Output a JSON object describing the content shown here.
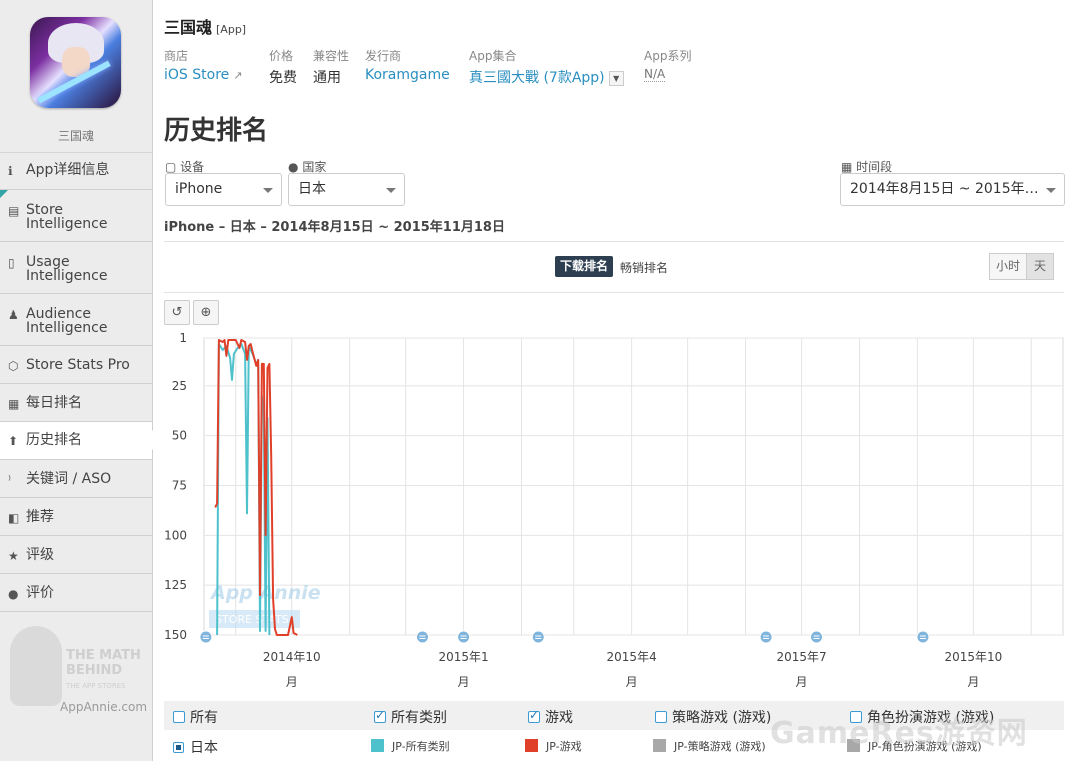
{
  "sidebar": {
    "app_name": "三国魂",
    "items": [
      {
        "icon": "info-icon",
        "glyph": "ℹ",
        "label": "App详细信息"
      },
      {
        "icon": "store-intelligence-icon",
        "glyph": "▤",
        "label": "Store Intelligence"
      },
      {
        "icon": "usage-intelligence-icon",
        "glyph": "▯",
        "label": "Usage Intelligence"
      },
      {
        "icon": "audience-intelligence-icon",
        "glyph": "♟",
        "label": "Audience Intelligence"
      },
      {
        "icon": "store-stats-pro-icon",
        "glyph": "⬡",
        "label": "Store Stats Pro"
      },
      {
        "icon": "calendar-icon",
        "glyph": "▦",
        "label": "每日排名"
      },
      {
        "icon": "arrow-up-icon",
        "glyph": "⬆",
        "label": "历史排名"
      },
      {
        "icon": "keyword-icon",
        "glyph": "⁾",
        "label": "关键词 / ASO"
      },
      {
        "icon": "featured-icon",
        "glyph": "◧",
        "label": "推荐"
      },
      {
        "icon": "star-icon",
        "glyph": "★",
        "label": "评级"
      },
      {
        "icon": "review-icon",
        "glyph": "●",
        "label": "评价"
      }
    ],
    "logo": {
      "line1": "THE MATH",
      "line2": "BEHIND",
      "line3": "THE APP STORES",
      "url": "AppAnnie.com"
    }
  },
  "header": {
    "title": "三国魂",
    "tag": "[App]",
    "meta": [
      {
        "label": "商店",
        "value": "iOS Store"
      },
      {
        "label": "价格",
        "value": "免费"
      },
      {
        "label": "兼容性",
        "value": "通用"
      },
      {
        "label": "发行商",
        "value": "Koramgame"
      },
      {
        "label": "App集合",
        "value": "真三國大戰 (7款App)"
      },
      {
        "label": "App系列",
        "value": "N/A"
      }
    ]
  },
  "section_title": "历史排名",
  "filters": {
    "device_label": "设备",
    "device_value": "iPhone",
    "country_label": "国家",
    "country_value": "日本",
    "period_label": "时间段",
    "period_value": "2014年8月15日 ~ 2015年…"
  },
  "subtitle": "iPhone – 日本 – 2014年8月15日 ~ 2015年11月18日",
  "tabs": {
    "active": "下载排名",
    "other": "畅销排名"
  },
  "granularity": {
    "hour": "小时",
    "day": "天"
  },
  "watermark_chart": {
    "line1": "App Annie",
    "line2": "STORE STATS"
  },
  "colors": {
    "all_categories": "#4dc1cc",
    "games": "#e0402a",
    "grey": "#a8a8a8",
    "accent": "#2a8fc0"
  },
  "chart_data": {
    "type": "line",
    "y_reversed": true,
    "ylim": [
      1,
      150
    ],
    "yticks": [
      1,
      25,
      50,
      75,
      100,
      125,
      150
    ],
    "xticks": [
      {
        "label": "2014年10月",
        "date": "2014-10-01"
      },
      {
        "label": "2015年1月",
        "date": "2015-01-01"
      },
      {
        "label": "2015年4月",
        "date": "2015-04-01"
      },
      {
        "label": "2015年7月",
        "date": "2015-07-01"
      },
      {
        "label": "2015年10月",
        "date": "2015-10-01"
      }
    ],
    "xlim": [
      "2014-08-15",
      "2015-11-18"
    ],
    "events": [
      "2014-08-16",
      "2014-12-10",
      "2015-01-01",
      "2015-02-10",
      "2015-06-12",
      "2015-07-09",
      "2015-09-04"
    ],
    "series": [
      {
        "name": "JP-所有类别",
        "color": "#4dc1cc",
        "points": [
          [
            "2014-08-22",
            150
          ],
          [
            "2014-08-23",
            4
          ],
          [
            "2014-08-25",
            7
          ],
          [
            "2014-08-27",
            5
          ],
          [
            "2014-08-29",
            11
          ],
          [
            "2014-08-30",
            22
          ],
          [
            "2014-08-31",
            9
          ],
          [
            "2014-09-02",
            6
          ],
          [
            "2014-09-04",
            4
          ],
          [
            "2014-09-06",
            9
          ],
          [
            "2014-09-07",
            89
          ],
          [
            "2014-09-08",
            5
          ],
          [
            "2014-09-10",
            9
          ],
          [
            "2014-09-12",
            14
          ],
          [
            "2014-09-13",
            15
          ],
          [
            "2014-09-14",
            148
          ],
          [
            "2014-09-15",
            30
          ],
          [
            "2014-09-16",
            38
          ],
          [
            "2014-09-17",
            148
          ],
          [
            "2014-09-18",
            41
          ],
          [
            "2014-09-19",
            150
          ]
        ]
      },
      {
        "name": "JP-游戏",
        "color": "#e0402a",
        "points": [
          [
            "2014-08-21",
            86
          ],
          [
            "2014-08-22",
            84
          ],
          [
            "2014-08-23",
            2
          ],
          [
            "2014-08-25",
            3
          ],
          [
            "2014-08-26",
            2
          ],
          [
            "2014-08-27",
            10
          ],
          [
            "2014-08-28",
            2
          ],
          [
            "2014-08-30",
            2
          ],
          [
            "2014-09-01",
            2
          ],
          [
            "2014-09-03",
            6
          ],
          [
            "2014-09-04",
            2
          ],
          [
            "2014-09-06",
            3
          ],
          [
            "2014-09-07",
            12
          ],
          [
            "2014-09-08",
            5
          ],
          [
            "2014-09-09",
            4
          ],
          [
            "2014-09-10",
            8
          ],
          [
            "2014-09-12",
            15
          ],
          [
            "2014-09-13",
            12
          ],
          [
            "2014-09-14",
            130
          ],
          [
            "2014-09-15",
            14
          ],
          [
            "2014-09-16",
            14
          ],
          [
            "2014-09-17",
            100
          ],
          [
            "2014-09-18",
            16
          ],
          [
            "2014-09-19",
            14
          ],
          [
            "2014-09-20",
            60
          ],
          [
            "2014-09-21",
            132
          ],
          [
            "2014-09-22",
            147
          ],
          [
            "2014-09-23",
            150
          ],
          [
            "2014-09-29",
            150
          ],
          [
            "2014-10-01",
            141
          ],
          [
            "2014-10-02",
            149
          ],
          [
            "2014-10-04",
            150
          ]
        ]
      }
    ]
  },
  "legend": {
    "header": [
      {
        "label": "所有",
        "checked": false
      },
      {
        "label": "所有类别",
        "checked": true
      },
      {
        "label": "游戏",
        "checked": true
      },
      {
        "label": "策略游戏 (游戏)",
        "checked": false
      },
      {
        "label": "角色扮演游戏 (游戏)",
        "checked": false
      }
    ],
    "row_label": "日本",
    "series": [
      {
        "label": "JP-所有类别",
        "color": "#4dc1cc"
      },
      {
        "label": "JP-游戏",
        "color": "#e0402a"
      },
      {
        "label": "JP-策略游戏 (游戏)",
        "color": "#a8a8a8"
      },
      {
        "label": "JP-角色扮演游戏 (游戏)",
        "color": "#a8a8a8"
      }
    ]
  },
  "site_watermark": "GameRes游资网"
}
